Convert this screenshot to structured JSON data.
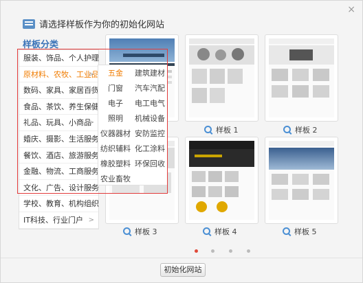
{
  "dialog": {
    "title": "请选择样板作为你的初始化网站",
    "close_label": "×"
  },
  "sidebar": {
    "title": "样板分类",
    "items": [
      {
        "label": "服装、饰品、个人护理",
        "arrow": ">"
      },
      {
        "label": "原材料、农牧、工业品",
        "arrow": ">"
      },
      {
        "label": "数码、家具、家居百货",
        "arrow": ">"
      },
      {
        "label": "食品、茶饮、养生保健",
        "arrow": ">"
      },
      {
        "label": "礼品、玩具、小商品",
        "arrow": ">"
      },
      {
        "label": "婚庆、摄影、生活服务",
        "arrow": ">"
      },
      {
        "label": "餐饮、酒店、旅游服务",
        "arrow": ">"
      },
      {
        "label": "金融、物流、工商服务",
        "arrow": ">"
      },
      {
        "label": "文化、广告、设计服务",
        "arrow": ">"
      },
      {
        "label": "学校、教育、机构组织",
        "arrow": ">"
      },
      {
        "label": "IT科技、行业门户",
        "arrow": ">"
      }
    ],
    "active_index": 1
  },
  "subcategories": [
    "五金",
    "建筑建材",
    "门窗",
    "汽车汽配",
    "电子",
    "电工电气",
    "照明",
    "机械设备",
    "仪器器材",
    "安防监控",
    "纺织辅料",
    "化工涂料",
    "橡胶塑料",
    "环保回收",
    "农业畜牧"
  ],
  "templates": [
    {
      "label": "样板 1"
    },
    {
      "label": "样板 2"
    },
    {
      "label": "样板 3"
    },
    {
      "label": "样板 4"
    },
    {
      "label": "样板 5"
    }
  ],
  "pagination": {
    "pages": 4,
    "active": 0
  },
  "footer": {
    "button_label": "初始化网站"
  },
  "colors": {
    "accent": "#3a73b8",
    "active": "#f07c00",
    "highlight": "#e23a3a"
  }
}
